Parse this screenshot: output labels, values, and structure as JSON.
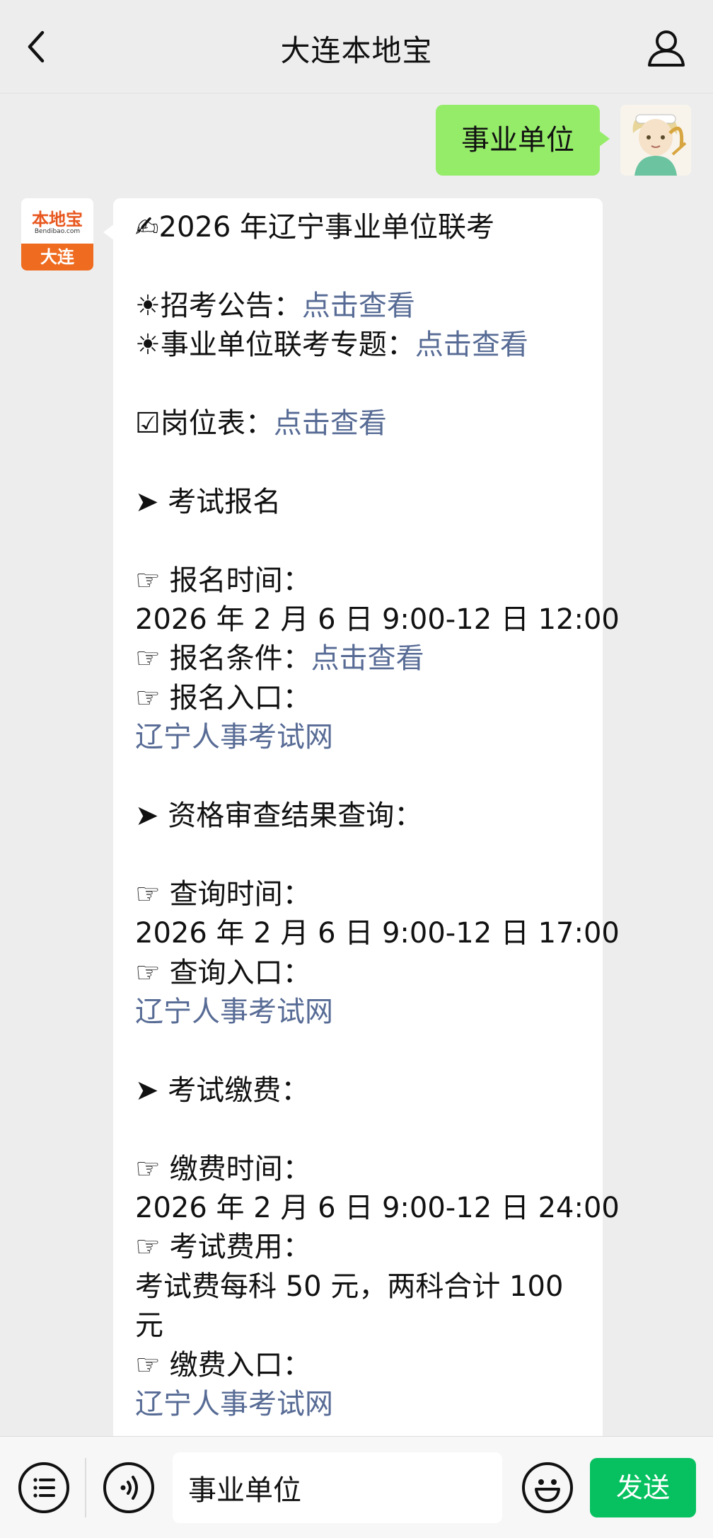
{
  "header": {
    "title": "大连本地宝"
  },
  "user_message": {
    "text": "事业单位"
  },
  "bot_avatar": {
    "brand": "本地宝",
    "site": "Bendibao.com",
    "city": "大连"
  },
  "bot_message": {
    "lines": [
      {
        "text": "✍2026 年辽宁事业单位联考"
      },
      {
        "blank": true
      },
      {
        "text": "☀招考公告：",
        "link": "点击查看"
      },
      {
        "text": "☀事业单位联考专题：",
        "link": "点击查看"
      },
      {
        "blank": true
      },
      {
        "text": "☑岗位表：",
        "link": "点击查看"
      },
      {
        "blank": true
      },
      {
        "text": "➤ 考试报名"
      },
      {
        "blank": true
      },
      {
        "text": "☞ 报名时间："
      },
      {
        "text": "2026 年 2 月 6 日 9:00-12 日 12:00"
      },
      {
        "text": "☞ 报名条件：",
        "link": "点击查看"
      },
      {
        "text": "☞ 报名入口："
      },
      {
        "text": "",
        "link": "辽宁人事考试网"
      },
      {
        "blank": true
      },
      {
        "text": "➤ 资格审查结果查询："
      },
      {
        "blank": true
      },
      {
        "text": "☞ 查询时间："
      },
      {
        "text": "2026 年 2 月 6 日 9:00-12 日 17:00"
      },
      {
        "text": "☞ 查询入口："
      },
      {
        "text": "",
        "link": "辽宁人事考试网"
      },
      {
        "blank": true
      },
      {
        "text": "➤ 考试缴费："
      },
      {
        "blank": true
      },
      {
        "text": "☞ 缴费时间："
      },
      {
        "text": "2026 年 2 月 6 日 9:00-12 日 24:00"
      },
      {
        "text": "☞ 考试费用："
      },
      {
        "text": "考试费每科 50 元，两科合计 100"
      },
      {
        "text": "元"
      },
      {
        "text": "☞ 缴费入口："
      },
      {
        "text": "",
        "link": "辽宁人事考试网"
      }
    ]
  },
  "input_bar": {
    "value": "事业单位",
    "send_label": "发送"
  },
  "colors": {
    "background": "#ededed",
    "user_bubble": "#95ec69",
    "link": "#576b95",
    "send_button": "#07c160",
    "bot_brand": "#ef6b1f"
  },
  "icons": [
    "back-arrow-icon",
    "user-profile-icon",
    "menu-list-icon",
    "voice-icon",
    "emoji-icon"
  ]
}
